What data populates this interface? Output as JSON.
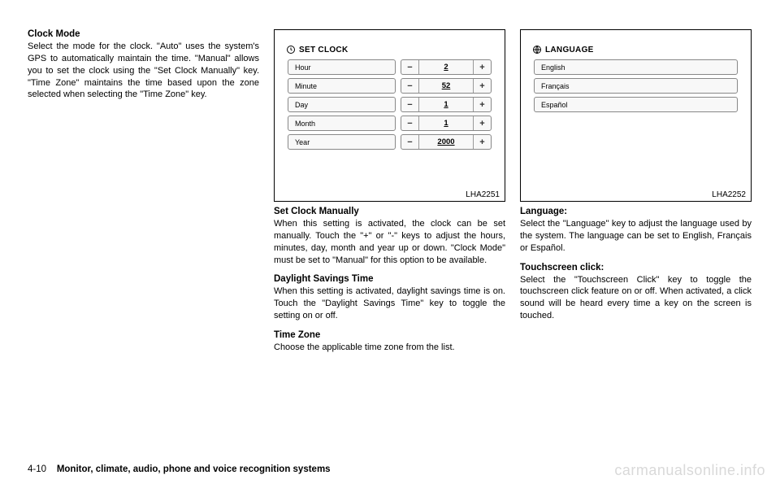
{
  "col1": {
    "heading": "Clock Mode",
    "para": "Select the mode for the clock. \"Auto\" uses the system's GPS to automatically maintain the time. \"Manual\" allows you to set the clock using the \"Set Clock Manually\" key. \"Time Zone\" maintains the time based upon the zone selected when selecting the \"Time Zone\" key."
  },
  "col2": {
    "screen": {
      "title": "SET CLOCK",
      "rows": [
        {
          "label": "Hour",
          "value": "2"
        },
        {
          "label": "Minute",
          "value": "52"
        },
        {
          "label": "Day",
          "value": "1"
        },
        {
          "label": "Month",
          "value": "1"
        },
        {
          "label": "Year",
          "value": "2000"
        }
      ],
      "id": "LHA2251"
    },
    "h1": "Set Clock Manually",
    "p1": "When this setting is activated, the clock can be set manually. Touch the \"+\" or \"-\" keys to adjust the hours, minutes, day, month and year up or down. \"Clock Mode\" must be set to \"Manual\" for this option to be available.",
    "h2": "Daylight Savings Time",
    "p2": "When this setting is activated, daylight savings time is on. Touch the \"Daylight Savings Time\" key to toggle the setting on or off.",
    "h3": "Time Zone",
    "p3": "Choose the applicable time zone from the list."
  },
  "col3": {
    "screen": {
      "title": "LANGUAGE",
      "rows": [
        {
          "label": "English"
        },
        {
          "label": "Français"
        },
        {
          "label": "Español"
        }
      ],
      "id": "LHA2252"
    },
    "h1": "Language:",
    "p1": "Select the \"Language\" key to adjust the language used by the system. The language can be set to English, Français or Español.",
    "h2": "Touchscreen click:",
    "p2": "Select the \"Touchscreen Click\" key to toggle the touchscreen click feature on or off. When activated, a click sound will be heard every time a key on the screen is touched."
  },
  "footer": {
    "pagenum": "4-10",
    "section": "Monitor, climate, audio, phone and voice recognition systems"
  },
  "watermark": "carmanualsonline.info",
  "glyphs": {
    "minus": "−",
    "plus": "+"
  }
}
